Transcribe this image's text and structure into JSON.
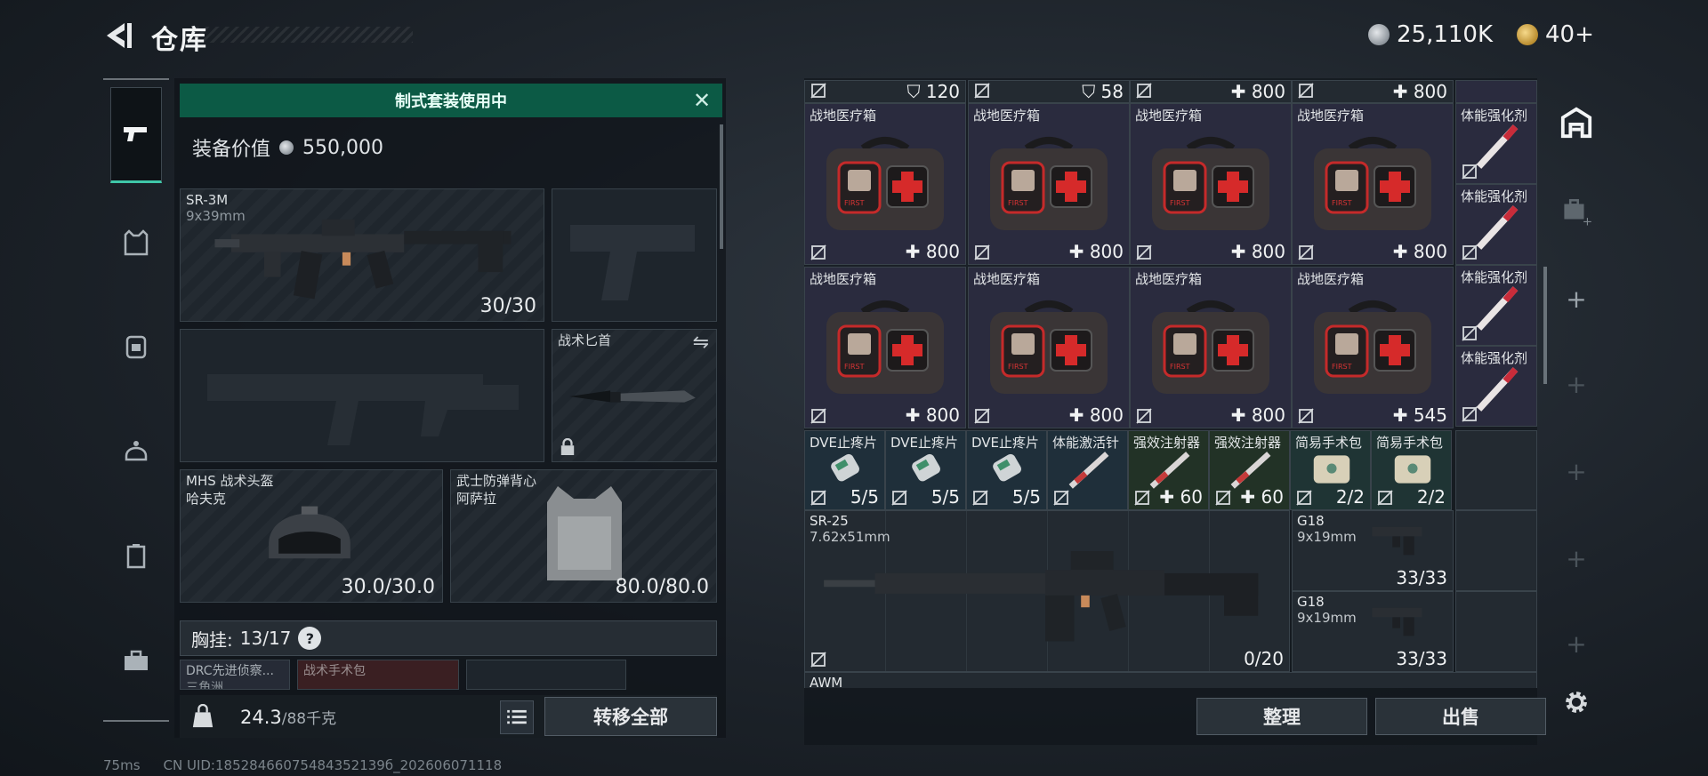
{
  "header": {
    "title": "仓库",
    "currency_silver": "25,110K",
    "currency_gold": "40+"
  },
  "equip": {
    "banner_text": "制式套装使用中",
    "value_label": "装备价值",
    "value": "550,000",
    "primary": {
      "name": "SR-3M",
      "caliber": "9x39mm",
      "ammo": "30/30"
    },
    "knife": {
      "name": "战术匕首"
    },
    "helmet": {
      "name": "MHS 战术头盔",
      "sub": "哈夫克",
      "durability": "30.0/30.0"
    },
    "vest": {
      "name": "武士防弹背心",
      "sub": "阿萨拉",
      "durability": "80.0/80.0"
    },
    "chest_label": "胸挂:",
    "chest_count": "13/17",
    "chest_help": "?",
    "chest_item1": "DRC先进侦察...",
    "chest_item1_sub": "三角洲",
    "chest_item2": "战术手术包",
    "weight": "24.3",
    "weight_max": "/88千克",
    "transfer_all": "转移全部"
  },
  "stash": {
    "top_row": [
      "120",
      "58",
      "800",
      "800"
    ],
    "medkits_row1": [
      {
        "name": "战地医疗箱",
        "val": "800"
      },
      {
        "name": "战地医疗箱",
        "val": "800"
      },
      {
        "name": "战地医疗箱",
        "val": "800"
      },
      {
        "name": "战地医疗箱",
        "val": "800"
      }
    ],
    "medkits_row2": [
      {
        "name": "战地医疗箱",
        "val": "800"
      },
      {
        "name": "战地医疗箱",
        "val": "800"
      },
      {
        "name": "战地医疗箱",
        "val": "800"
      },
      {
        "name": "战地医疗箱",
        "val": "545"
      }
    ],
    "side_column": [
      "体能强化剂",
      "体能强化剂",
      "体能强化剂",
      "体能强化剂"
    ],
    "small_row": [
      {
        "name": "DVE止疼片",
        "val": "5/5"
      },
      {
        "name": "DVE止疼片",
        "val": "5/5"
      },
      {
        "name": "DVE止疼片",
        "val": "5/5"
      },
      {
        "name": "体能激活针",
        "val": ""
      },
      {
        "name": "强效注射器",
        "val": "60"
      },
      {
        "name": "强效注射器",
        "val": "60"
      },
      {
        "name": "简易手术包",
        "val": "2/2"
      },
      {
        "name": "简易手术包",
        "val": "2/2"
      }
    ],
    "sr25": {
      "name": "SR-25",
      "caliber": "7.62x51mm",
      "ammo": "0/20"
    },
    "g18_a": {
      "name": "G18",
      "caliber": "9x19mm",
      "ammo": "33/33"
    },
    "g18_b": {
      "name": "G18",
      "caliber": "9x19mm",
      "ammo": "33/33"
    },
    "awm": {
      "name": "AWM"
    },
    "sort_label": "整理",
    "sell_label": "出售"
  },
  "status": {
    "ping": "75ms",
    "uid": "CN UID:18528466075484352139б_202606071118"
  },
  "colors": {
    "banner": "#0c5a45",
    "accent": "#3fc7a8",
    "purple_cell": "#2a2b3e",
    "blue_cell": "#1f2f3a"
  }
}
